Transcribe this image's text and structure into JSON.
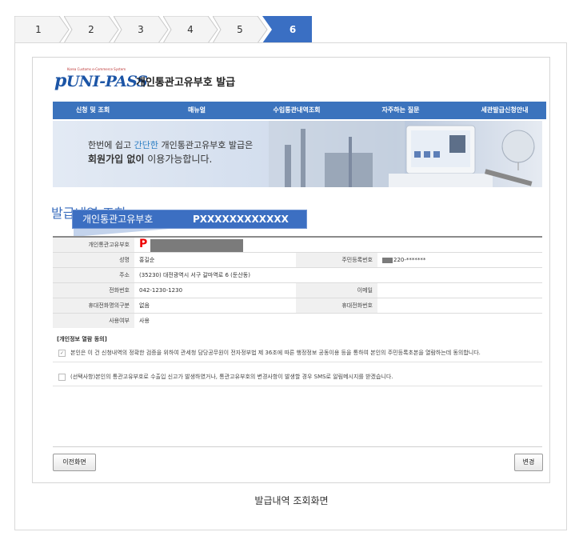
{
  "steps": [
    "1",
    "2",
    "3",
    "4",
    "5",
    "6"
  ],
  "active_step": "6",
  "logo": {
    "small": "Korea Customs e-Commerce System",
    "main": "UNI-PASS",
    "mark": "p",
    "title": "개인통관고유부호 발급"
  },
  "nav": [
    "신청 및 조회",
    "매뉴얼",
    "수입통관내역조회",
    "자주하는 질문",
    "세관발급신청안내"
  ],
  "banner": {
    "line1_a": "한번에 쉽고 ",
    "line1_hl": "간단한",
    "line1_b": " 개인통관고유부호 발급은",
    "line2_bold": "회원가입 없이",
    "line2_rest": " 이용가능합니다."
  },
  "section_title": "발급내역 조회",
  "callout": {
    "label": "개인통관고유부호",
    "value": "PXXXXXXXXXXXX"
  },
  "table": {
    "code_label": "개인통관고유부호",
    "code_prefix": "P",
    "name_label": "성명",
    "name_value": "홍길순",
    "rrn_label": "주민등록번호",
    "rrn_value": "220-*******",
    "addr_label": "주소",
    "addr_value": "(35230)  대전광역시 서구 갈마역로 6 (둔산동)",
    "phone_label": "전화번호",
    "phone_value": "042-1230-1230",
    "email_label": "이메일",
    "email_value": "",
    "mobile_type_label": "휴대전화명의구분",
    "mobile_type_value": "없음",
    "mobile_label": "휴대전화번호",
    "mobile_value": "",
    "use_label": "사용여부",
    "use_value": "사용"
  },
  "consent": {
    "title": "[개인정보 열람 동의]",
    "item1": "본인은 이 건 신청내역의 정확한 검증을 위하여 관세청 담당공무원이 전자정부법 제 36조에 따른 행정정보 공동이용 등을 통하여 본인의 주민등록초본을 열람하는데 동의합니다.",
    "item2": "(선택사항)본인의 통관고유부호로 수출입 신고가 발생하였거나, 통관고유부호의 변경사항이 발생할 경우 SMS로 알림메시지를 받겠습니다."
  },
  "buttons": {
    "prev": "이전화면",
    "change": "변경"
  },
  "caption": "발급내역 조회화면",
  "colors": {
    "accent": "#3b73bd",
    "active_step": "#3a6fc3",
    "redact": "#7b7b7b"
  }
}
